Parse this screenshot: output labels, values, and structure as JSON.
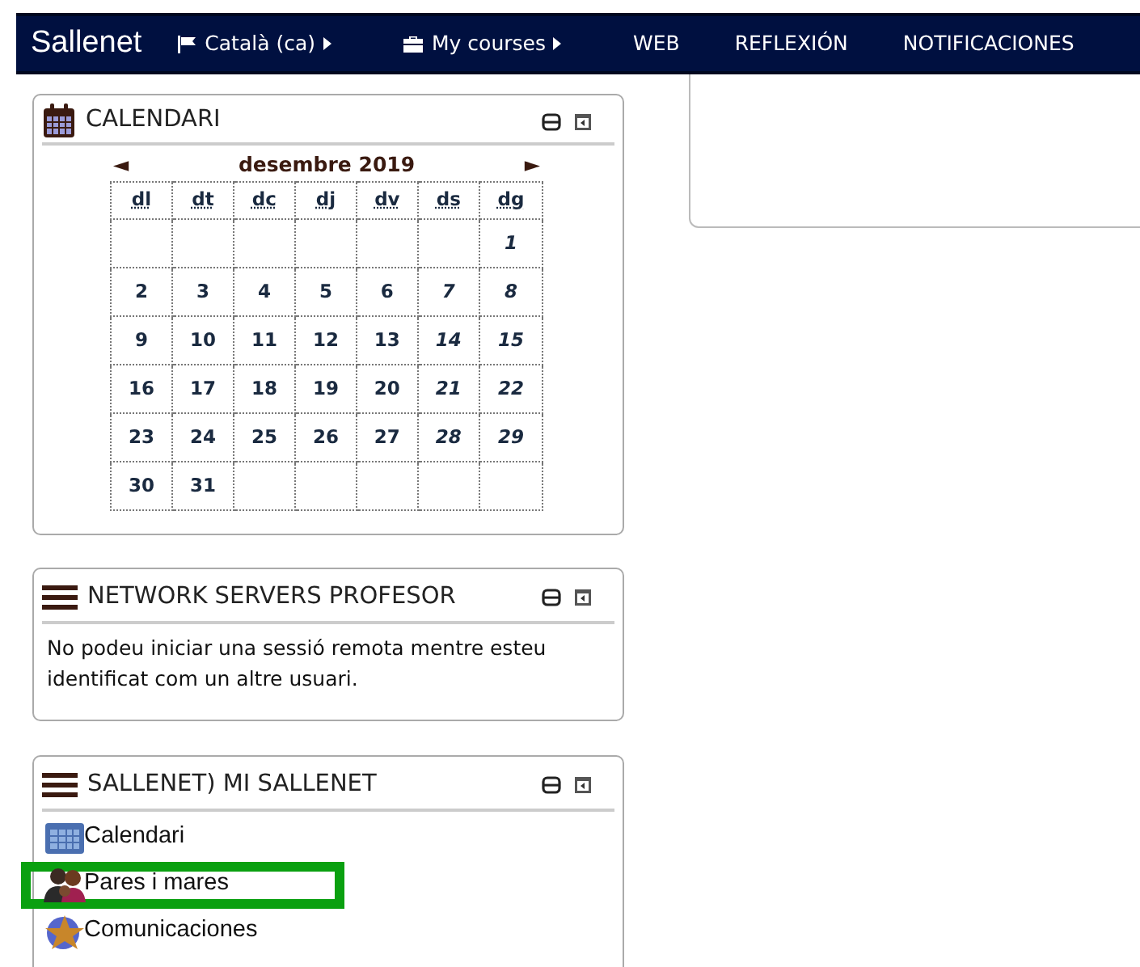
{
  "navbar": {
    "brand": "Sallenet",
    "items": [
      {
        "label": "Català (ca)",
        "kind": "language"
      },
      {
        "label": "My courses",
        "kind": "courses"
      },
      {
        "label": "WEB",
        "kind": "link"
      },
      {
        "label": "REFLEXIÓN",
        "kind": "link"
      },
      {
        "label": "NOTIFICACIONES",
        "kind": "link"
      }
    ]
  },
  "calendar_block": {
    "title": "CALENDARI",
    "month": "desembre 2019",
    "prev": "◄",
    "next": "►",
    "weekdays": [
      "dl",
      "dt",
      "dc",
      "dj",
      "dv",
      "ds",
      "dg"
    ],
    "weeks": [
      [
        {
          "kind": "blank"
        },
        {
          "kind": "blank"
        },
        {
          "kind": "blank"
        },
        {
          "kind": "blank"
        },
        {
          "kind": "blank"
        },
        {
          "kind": "blank"
        },
        {
          "kind": "day",
          "label": "1",
          "weekend": true
        }
      ],
      [
        {
          "kind": "day",
          "label": "2",
          "weekend": false
        },
        {
          "kind": "day",
          "label": "3",
          "weekend": false
        },
        {
          "kind": "day",
          "label": "4",
          "weekend": false
        },
        {
          "kind": "day",
          "label": "5",
          "weekend": false
        },
        {
          "kind": "day",
          "label": "6",
          "weekend": false
        },
        {
          "kind": "day",
          "label": "7",
          "weekend": true
        },
        {
          "kind": "day",
          "label": "8",
          "weekend": true
        }
      ],
      [
        {
          "kind": "day",
          "label": "9",
          "weekend": false
        },
        {
          "kind": "day",
          "label": "10",
          "weekend": false
        },
        {
          "kind": "day",
          "label": "11",
          "weekend": false
        },
        {
          "kind": "day",
          "label": "12",
          "weekend": false
        },
        {
          "kind": "day",
          "label": "13",
          "weekend": false
        },
        {
          "kind": "day",
          "label": "14",
          "weekend": true
        },
        {
          "kind": "day",
          "label": "15",
          "weekend": true
        }
      ],
      [
        {
          "kind": "day",
          "label": "16",
          "weekend": false
        },
        {
          "kind": "day",
          "label": "17",
          "weekend": false
        },
        {
          "kind": "day",
          "label": "18",
          "weekend": false
        },
        {
          "kind": "day",
          "label": "19",
          "weekend": false
        },
        {
          "kind": "day",
          "label": "20",
          "weekend": false
        },
        {
          "kind": "day",
          "label": "21",
          "weekend": true
        },
        {
          "kind": "day",
          "label": "22",
          "weekend": true
        }
      ],
      [
        {
          "kind": "day",
          "label": "23",
          "weekend": false
        },
        {
          "kind": "day",
          "label": "24",
          "weekend": false
        },
        {
          "kind": "day",
          "label": "25",
          "weekend": false
        },
        {
          "kind": "day",
          "label": "26",
          "weekend": false
        },
        {
          "kind": "day",
          "label": "27",
          "weekend": false
        },
        {
          "kind": "day",
          "label": "28",
          "weekend": true
        },
        {
          "kind": "day",
          "label": "29",
          "weekend": true
        }
      ],
      [
        {
          "kind": "day",
          "label": "30",
          "weekend": false
        },
        {
          "kind": "day",
          "label": "31",
          "weekend": false
        },
        {
          "kind": "blank"
        },
        {
          "kind": "blank"
        },
        {
          "kind": "blank"
        },
        {
          "kind": "blank"
        },
        {
          "kind": "blank"
        }
      ]
    ]
  },
  "network_block": {
    "title": "NETWORK SERVERS PROFESOR",
    "message": "No podeu iniciar una sessió remota mentre esteu identificat com un altre usuari."
  },
  "sallenet_block": {
    "title": "SALLENET) MI SALLENET",
    "items": [
      {
        "label": "Calendari",
        "kind": "calendar",
        "highlighted": false
      },
      {
        "label": "Pares i mares",
        "kind": "parents",
        "highlighted": true
      },
      {
        "label": "Comunicaciones",
        "kind": "communications",
        "highlighted": false
      }
    ]
  }
}
